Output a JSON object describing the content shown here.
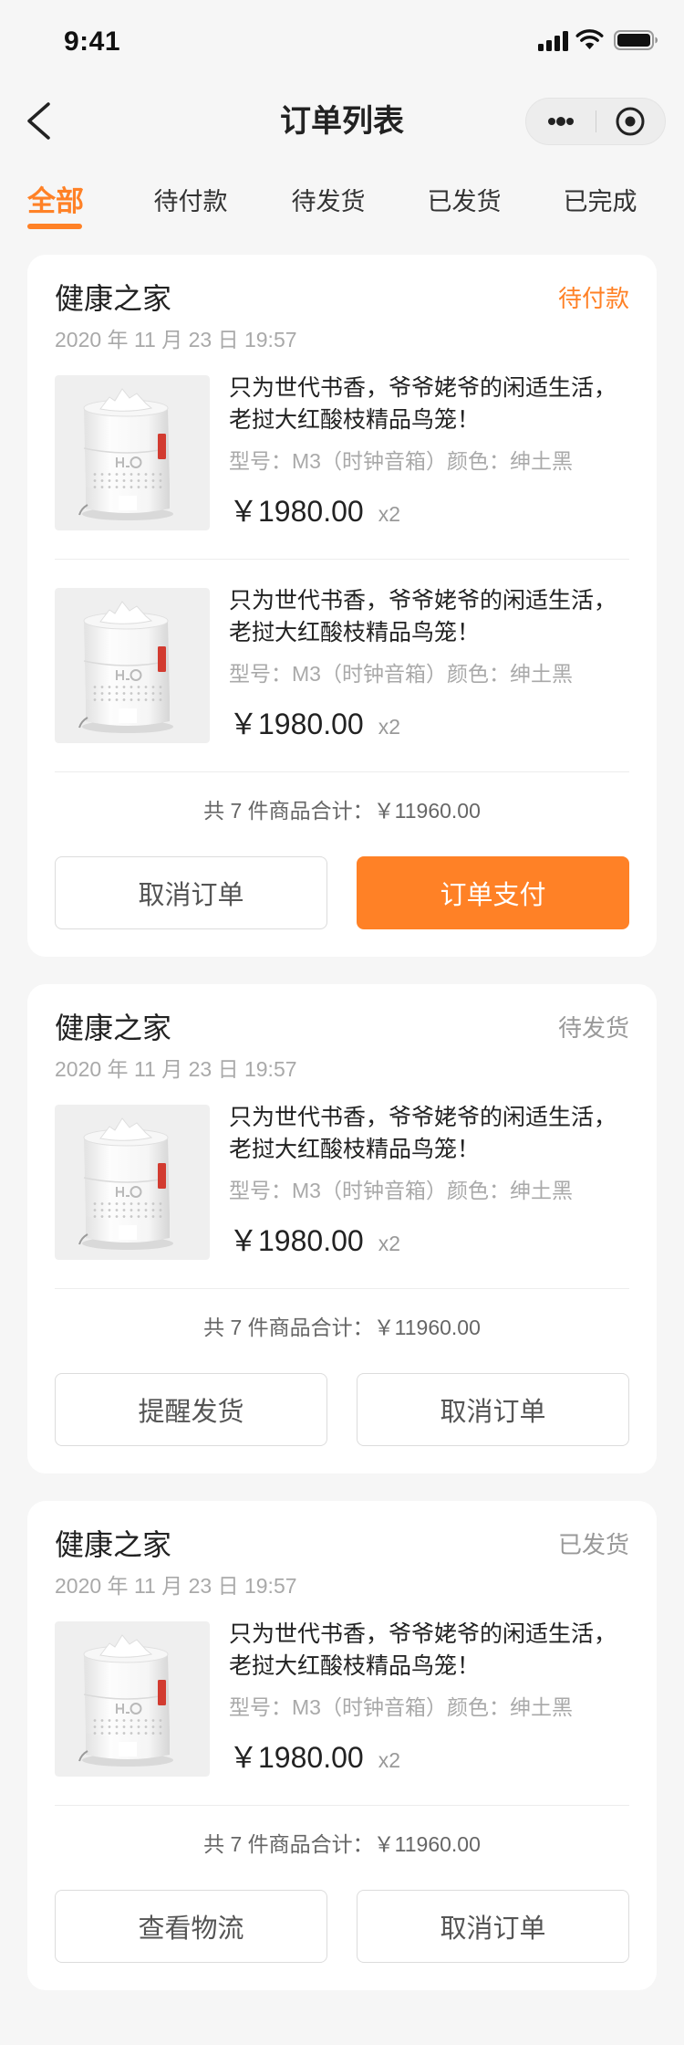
{
  "status_bar": {
    "time": "9:41",
    "icons": [
      "signal-icon",
      "wifi-icon",
      "battery-icon"
    ]
  },
  "nav": {
    "title": "订单列表",
    "back_icon": "chevron-left-icon",
    "capsule_icons": [
      "more-dots-icon",
      "target-circle-icon"
    ]
  },
  "tabs": [
    {
      "label": "全部",
      "active": true
    },
    {
      "label": "待付款",
      "active": false
    },
    {
      "label": "待发货",
      "active": false
    },
    {
      "label": "已发货",
      "active": false
    },
    {
      "label": "已完成",
      "active": false
    }
  ],
  "colors": {
    "accent": "#ff8126",
    "status_muted": "#999999",
    "page_background": "#f6f6f6",
    "card_background": "#ffffff"
  },
  "orders": [
    {
      "shop": "健康之家",
      "status": "待付款",
      "status_color": "#ff8126",
      "date": "2020 年 11 月 23 日 19:57",
      "items": [
        {
          "image": "humidifier-product-image",
          "title_lines": [
            "只为世代书香，爷爷姥爷的闲适生活，",
            "老挝大红酸枝精品鸟笼！"
          ],
          "spec": "型号：M3（时钟音箱）颜色：绅土黑",
          "price": "￥1980.00",
          "quantity": "x2"
        },
        {
          "image": "humidifier-product-image",
          "title_lines": [
            "只为世代书香，爷爷姥爷的闲适生活，",
            "老挝大红酸枝精品鸟笼！"
          ],
          "spec": "型号：M3（时钟音箱）颜色：绅土黑",
          "price": "￥1980.00",
          "quantity": "x2"
        }
      ],
      "summary": "共 7 件商品合计：￥11960.00",
      "actions": [
        {
          "label": "取消订单"
        },
        {
          "label": "订单支付"
        }
      ]
    },
    {
      "shop": "健康之家",
      "status": "待发货",
      "status_color": "#999999",
      "date": "2020 年 11 月 23 日 19:57",
      "items": [
        {
          "image": "humidifier-product-image",
          "title_lines": [
            "只为世代书香，爷爷姥爷的闲适生活，",
            "老挝大红酸枝精品鸟笼！"
          ],
          "spec": "型号：M3（时钟音箱）颜色：绅土黑",
          "price": "￥1980.00",
          "quantity": "x2"
        }
      ],
      "summary": "共 7 件商品合计：￥11960.00",
      "actions": [
        {
          "label": "提醒发货"
        },
        {
          "label": "取消订单"
        }
      ]
    },
    {
      "shop": "健康之家",
      "status": "已发货",
      "status_color": "#999999",
      "date": "2020 年 11 月 23 日 19:57",
      "items": [
        {
          "image": "humidifier-product-image",
          "title_lines": [
            "只为世代书香，爷爷姥爷的闲适生活，",
            "老挝大红酸枝精品鸟笼！"
          ],
          "spec": "型号：M3（时钟音箱）颜色：绅土黑",
          "price": "￥1980.00",
          "quantity": "x2"
        }
      ],
      "summary": "共 7 件商品合计：￥11960.00",
      "actions": [
        {
          "label": "查看物流"
        },
        {
          "label": "取消订单"
        }
      ]
    }
  ]
}
